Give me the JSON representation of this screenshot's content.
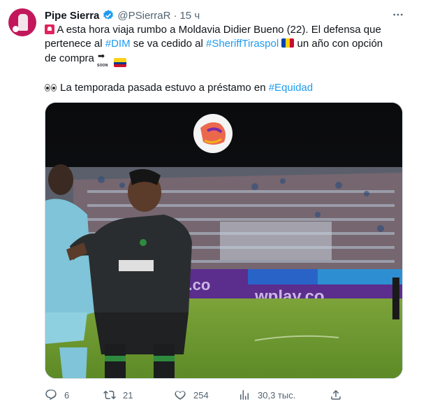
{
  "author": {
    "name": "Pipe Sierra",
    "handle": "@PSierraR",
    "separator": "·",
    "time": "15 ч"
  },
  "tweet": {
    "line1_a": "A esta hora viaja rumbo a Moldavia Didier Bueno (22). El defensa que",
    "line2_a": "pertenece al ",
    "tag_dim": "#DIM",
    "line2_b": " se va cedido al ",
    "tag_sheriff": "#SheriffTiraspol",
    "line2_c": " un año con opción",
    "line3_a": "de compra ",
    "soon_label": "SOON",
    "line4_a": "La temporada pasada estuvo a préstamo en ",
    "tag_equidad": "#Equidad"
  },
  "photo": {
    "board_text": "wplay.co"
  },
  "actions": {
    "replies": "6",
    "retweets": "21",
    "likes": "254",
    "views": "30,3 тыс."
  },
  "icons": {
    "verified": "verified-badge-icon",
    "more": "more-icon",
    "reply": "reply-icon",
    "retweet": "retweet-icon",
    "like": "heart-icon",
    "views": "views-icon",
    "share": "share-icon"
  },
  "colors": {
    "link": "#1d9bf0",
    "secondary": "#536471",
    "verified": "#1d9bf0"
  }
}
